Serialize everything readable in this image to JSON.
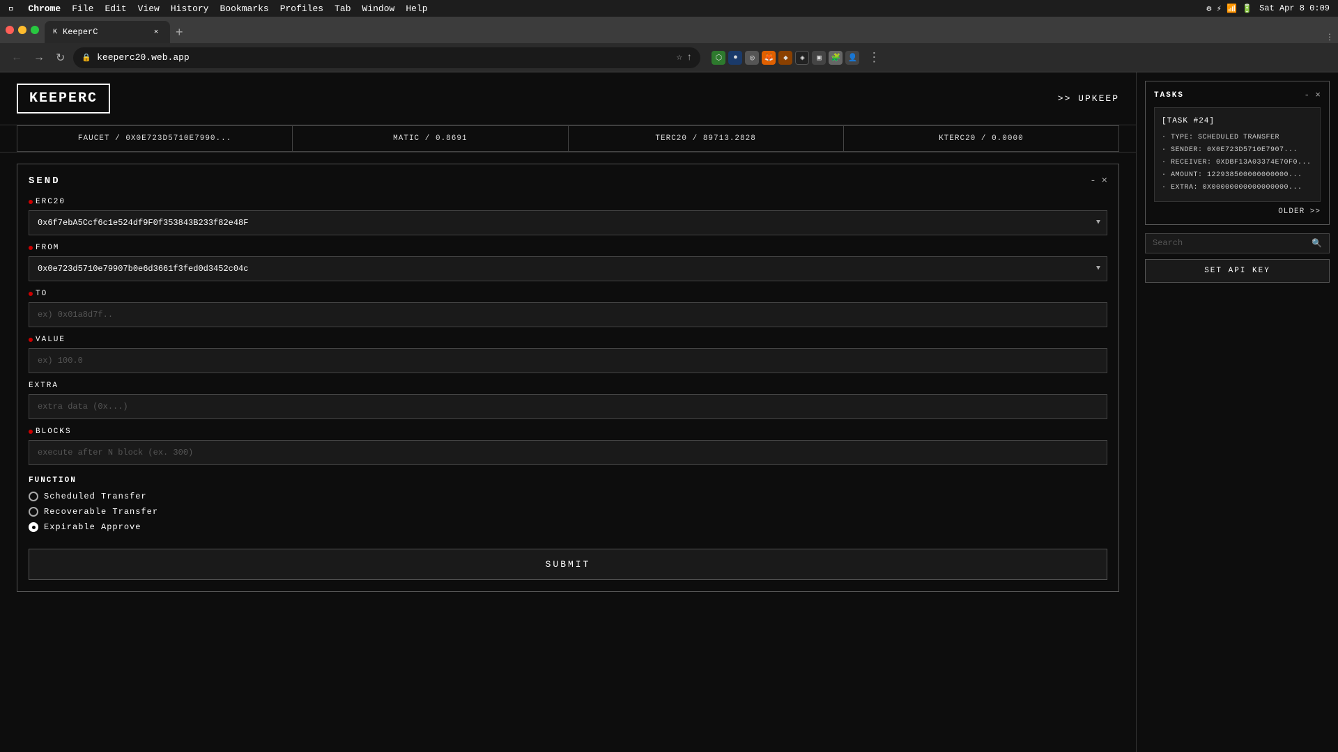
{
  "menubar": {
    "apple": "⌘",
    "items": [
      "Chrome",
      "File",
      "Edit",
      "View",
      "History",
      "Bookmarks",
      "Profiles",
      "Tab",
      "Window",
      "Help"
    ],
    "right": {
      "datetime": "Sat Apr 8  0:09"
    }
  },
  "chrome": {
    "tab": {
      "title": "KeeperC",
      "favicon": "K"
    },
    "url": "keeperc20.web.app"
  },
  "header": {
    "logo": "KEEPERC",
    "upkeep": ">> UPKEEP"
  },
  "stats": [
    {
      "label": "FAUCET / 0X0E723D5710E7990..."
    },
    {
      "label": "MATIC / 0.8691"
    },
    {
      "label": "TERC20 / 89713.2828"
    },
    {
      "label": "KTERC20 / 0.0000"
    }
  ],
  "send_panel": {
    "title": "SEND",
    "minimize": "-",
    "close": "×",
    "fields": {
      "erc20": {
        "label": "ERC20",
        "value": "0x6f7ebA5Ccf6c1e524df9F0f353843B233f82e48F",
        "required": true
      },
      "from": {
        "label": "FROM",
        "value": "0x0e723d5710e79907b0e6d3661f3fed0d3452c04c",
        "required": true
      },
      "to": {
        "label": "TO",
        "placeholder": "ex) 0x01a8d7f..",
        "required": true
      },
      "value": {
        "label": "VALUE",
        "placeholder": "ex) 100.0",
        "required": true
      },
      "extra": {
        "label": "EXTRA",
        "placeholder": "extra data (0x...)",
        "required": false
      },
      "blocks": {
        "label": "BLOCKS",
        "placeholder": "execute after N block (ex. 300)",
        "required": true
      }
    },
    "function": {
      "label": "FUNCTION",
      "options": [
        {
          "id": "scheduled",
          "label": "Scheduled Transfer",
          "selected": false
        },
        {
          "id": "recoverable",
          "label": "Recoverable Transfer",
          "selected": false
        },
        {
          "id": "expirable",
          "label": "Expirable Approve",
          "selected": true
        }
      ]
    },
    "submit_label": "SUBMIT"
  },
  "tasks_panel": {
    "title": "TASKS",
    "minimize": "-",
    "close": "×",
    "task": {
      "id": "[TASK #24]",
      "details": [
        "· TYPE: SCHEDULED TRANSFER",
        "· SENDER: 0X0E723D5710E7907...",
        "· RECEIVER: 0XDBF13A03374E70F0...",
        "· AMOUNT: 122938500000000000...",
        "· EXTRA: 0X00000000000000000..."
      ]
    },
    "older_label": "OLDER >>"
  },
  "search": {
    "placeholder": "Search",
    "api_key_label": "SET API KEY"
  }
}
